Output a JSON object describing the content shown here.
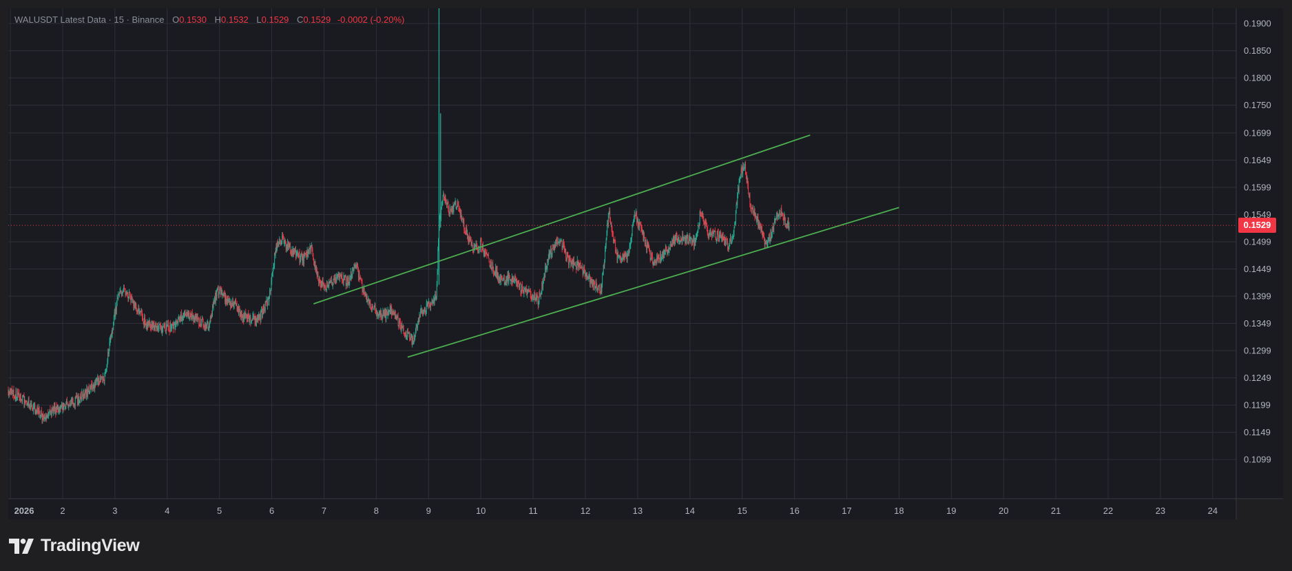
{
  "legend": {
    "symbol": "WALUSDT Latest Data · 15 · Binance",
    "open_label": "O",
    "open": "0.1530",
    "high_label": "H",
    "high": "0.1532",
    "low_label": "L",
    "low": "0.1529",
    "close_label": "C",
    "close": "0.1529",
    "change": "-0.0002 (-0.20%)"
  },
  "brand": {
    "name": "TradingView"
  },
  "colors": {
    "background": "#1f1f21",
    "pane": "#1a1b20",
    "grid": "#2e3039",
    "up": "#22ab94",
    "down": "#f23645",
    "trendline": "#4caf50",
    "axis_text": "#b2b5be"
  },
  "chart_data": {
    "type": "candlestick",
    "symbol": "WALUSDT",
    "interval": "15",
    "exchange": "Binance",
    "x_unit": "day of January 2026",
    "x_ticks": [
      {
        "x": 1,
        "label": "2026"
      },
      {
        "x": 2,
        "label": "2"
      },
      {
        "x": 3,
        "label": "3"
      },
      {
        "x": 4,
        "label": "4"
      },
      {
        "x": 5,
        "label": "5"
      },
      {
        "x": 6,
        "label": "6"
      },
      {
        "x": 7,
        "label": "7"
      },
      {
        "x": 8,
        "label": "8"
      },
      {
        "x": 9,
        "label": "9"
      },
      {
        "x": 10,
        "label": "10"
      },
      {
        "x": 11,
        "label": "11"
      },
      {
        "x": 12,
        "label": "12"
      },
      {
        "x": 13,
        "label": "13"
      },
      {
        "x": 14,
        "label": "14"
      },
      {
        "x": 15,
        "label": "15"
      },
      {
        "x": 16,
        "label": "16"
      },
      {
        "x": 17,
        "label": "17"
      },
      {
        "x": 18,
        "label": "18"
      },
      {
        "x": 19,
        "label": "19"
      },
      {
        "x": 20,
        "label": "20"
      },
      {
        "x": 21,
        "label": "21"
      },
      {
        "x": 22,
        "label": "22"
      },
      {
        "x": 23,
        "label": "23"
      },
      {
        "x": 24,
        "label": "24"
      }
    ],
    "y_ticks": [
      "0.1900",
      "0.1850",
      "0.1800",
      "0.1750",
      "0.1699",
      "0.1649",
      "0.1599",
      "0.1549",
      "0.1499",
      "0.1449",
      "0.1399",
      "0.1349",
      "0.1299",
      "0.1249",
      "0.1199",
      "0.1149",
      "0.1099"
    ],
    "xlim": [
      0.96,
      24.45
    ],
    "ylim": [
      0.1027,
      0.1928
    ],
    "last_price": 0.1529,
    "last_price_label": "0.1529",
    "grid": true,
    "path": [
      [
        0.96,
        0.1225
      ],
      [
        1.15,
        0.1215
      ],
      [
        1.3,
        0.1205
      ],
      [
        1.5,
        0.119
      ],
      [
        1.65,
        0.1175
      ],
      [
        1.85,
        0.119
      ],
      [
        2.05,
        0.12
      ],
      [
        2.3,
        0.121
      ],
      [
        2.6,
        0.1235
      ],
      [
        2.8,
        0.125
      ],
      [
        2.95,
        0.134
      ],
      [
        3.05,
        0.1395
      ],
      [
        3.15,
        0.141
      ],
      [
        3.3,
        0.1395
      ],
      [
        3.5,
        0.1365
      ],
      [
        3.6,
        0.1345
      ],
      [
        3.9,
        0.134
      ],
      [
        4.15,
        0.1345
      ],
      [
        4.35,
        0.1368
      ],
      [
        4.55,
        0.1355
      ],
      [
        4.8,
        0.1345
      ],
      [
        4.95,
        0.141
      ],
      [
        5.1,
        0.1395
      ],
      [
        5.3,
        0.1385
      ],
      [
        5.45,
        0.136
      ],
      [
        5.75,
        0.1355
      ],
      [
        5.95,
        0.1395
      ],
      [
        6.08,
        0.149
      ],
      [
        6.2,
        0.1505
      ],
      [
        6.4,
        0.148
      ],
      [
        6.6,
        0.1465
      ],
      [
        6.75,
        0.149
      ],
      [
        6.9,
        0.1425
      ],
      [
        7.05,
        0.1415
      ],
      [
        7.25,
        0.1435
      ],
      [
        7.45,
        0.1425
      ],
      [
        7.6,
        0.1458
      ],
      [
        7.75,
        0.141
      ],
      [
        7.9,
        0.1378
      ],
      [
        8.1,
        0.1362
      ],
      [
        8.3,
        0.1372
      ],
      [
        8.5,
        0.134
      ],
      [
        8.7,
        0.1315
      ],
      [
        8.85,
        0.137
      ],
      [
        9.05,
        0.1385
      ],
      [
        9.15,
        0.1405
      ],
      [
        9.2,
        0.153
      ],
      [
        9.28,
        0.159
      ],
      [
        9.4,
        0.1555
      ],
      [
        9.55,
        0.157
      ],
      [
        9.7,
        0.152
      ],
      [
        9.85,
        0.1485
      ],
      [
        10.0,
        0.1495
      ],
      [
        10.2,
        0.1455
      ],
      [
        10.4,
        0.1425
      ],
      [
        10.55,
        0.1435
      ],
      [
        10.75,
        0.1415
      ],
      [
        10.9,
        0.1405
      ],
      [
        11.1,
        0.139
      ],
      [
        11.3,
        0.1475
      ],
      [
        11.5,
        0.1505
      ],
      [
        11.7,
        0.146
      ],
      [
        11.9,
        0.1455
      ],
      [
        12.1,
        0.1425
      ],
      [
        12.3,
        0.141
      ],
      [
        12.45,
        0.1555
      ],
      [
        12.6,
        0.147
      ],
      [
        12.8,
        0.147
      ],
      [
        12.95,
        0.155
      ],
      [
        13.1,
        0.151
      ],
      [
        13.3,
        0.146
      ],
      [
        13.5,
        0.1475
      ],
      [
        13.7,
        0.1505
      ],
      [
        13.9,
        0.1505
      ],
      [
        14.1,
        0.1495
      ],
      [
        14.2,
        0.1555
      ],
      [
        14.35,
        0.1515
      ],
      [
        14.55,
        0.151
      ],
      [
        14.75,
        0.149
      ],
      [
        14.85,
        0.1525
      ],
      [
        14.95,
        0.162
      ],
      [
        15.05,
        0.164
      ],
      [
        15.15,
        0.157
      ],
      [
        15.3,
        0.1535
      ],
      [
        15.45,
        0.1495
      ],
      [
        15.55,
        0.151
      ],
      [
        15.65,
        0.1545
      ],
      [
        15.75,
        0.1555
      ],
      [
        15.85,
        0.153
      ],
      [
        15.9,
        0.1529
      ]
    ],
    "spikes": [
      {
        "x": 9.2,
        "high": 0.195,
        "low": 0.142
      },
      {
        "x": 9.23,
        "high": 0.1735,
        "low": 0.1525
      }
    ],
    "trendlines": [
      {
        "from": [
          6.8,
          0.1385
        ],
        "to": [
          16.3,
          0.1695
        ]
      },
      {
        "from": [
          8.6,
          0.1287
        ],
        "to": [
          18.0,
          0.1562
        ]
      }
    ]
  }
}
